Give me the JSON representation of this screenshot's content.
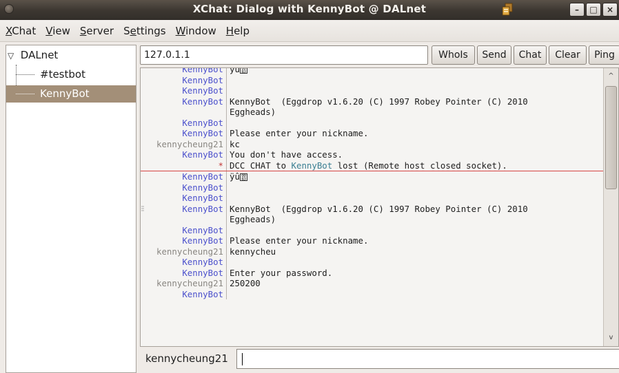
{
  "window": {
    "title": "XChat: Dialog with KennyBot @ DALnet",
    "controls": [
      "minimize",
      "maximize",
      "close"
    ],
    "app_icon": "xchat-icon"
  },
  "menubar": {
    "items": [
      {
        "label": "XChat",
        "mnemonic": "X"
      },
      {
        "label": "View",
        "mnemonic": "V"
      },
      {
        "label": "Server",
        "mnemonic": "S"
      },
      {
        "label": "Settings",
        "mnemonic": "e"
      },
      {
        "label": "Window",
        "mnemonic": "W"
      },
      {
        "label": "Help",
        "mnemonic": "H"
      }
    ]
  },
  "tree": {
    "network": "DALnet",
    "channels": [
      "#testbot",
      "KennyBot"
    ],
    "selected": "KennyBot"
  },
  "topic": {
    "value": "127.0.1.1"
  },
  "toolbar": {
    "buttons": [
      "WhoIs",
      "Send",
      "Chat",
      "Clear",
      "Ping"
    ]
  },
  "chat": {
    "lines": [
      {
        "nick": "KennyBot",
        "msg": "yu",
        "box": true
      },
      {
        "nick": "KennyBot",
        "msg": ""
      },
      {
        "nick": "KennyBot",
        "msg": ""
      },
      {
        "nick": "KennyBot",
        "msg": "KennyBot  (Eggdrop v1.6.20 (C) 1997 Robey Pointer (C) 2010"
      },
      {
        "nick": "",
        "msg": "Eggheads)"
      },
      {
        "nick": "KennyBot",
        "msg": ""
      },
      {
        "nick": "KennyBot",
        "msg": "Please enter your nickname."
      },
      {
        "nick": "kennycheung21",
        "msg": "kc",
        "self": true
      },
      {
        "nick": "KennyBot",
        "msg": "You don't have access."
      },
      {
        "nick": "*",
        "star": true,
        "msg_pre": "DCC CHAT to ",
        "msg_hl": "KennyBot",
        "msg_post": " lost (Remote host closed socket).",
        "marker_after": true
      },
      {
        "nick": "KennyBot",
        "msg": "ÿû",
        "box": true
      },
      {
        "nick": "KennyBot",
        "msg": ""
      },
      {
        "nick": "KennyBot",
        "msg": ""
      },
      {
        "nick": "KennyBot",
        "msg": "KennyBot  (Eggdrop v1.6.20 (C) 1997 Robey Pointer (C) 2010"
      },
      {
        "nick": "",
        "msg": "Eggheads)"
      },
      {
        "nick": "KennyBot",
        "msg": ""
      },
      {
        "nick": "KennyBot",
        "msg": "Please enter your nickname."
      },
      {
        "nick": "kennycheung21",
        "msg": "kennycheu",
        "self": true
      },
      {
        "nick": "KennyBot",
        "msg": ""
      },
      {
        "nick": "KennyBot",
        "msg": "Enter your password."
      },
      {
        "nick": "kennycheung21",
        "msg": "250200",
        "self": true
      },
      {
        "nick": "KennyBot",
        "msg": ""
      }
    ]
  },
  "input": {
    "nickname": "kennycheung21",
    "value": ""
  },
  "colors": {
    "titlebar": "#3c3731",
    "selection": "#a38f78",
    "nick": "#4b50cc",
    "self_nick": "#8a8782",
    "marker": "#d64444"
  }
}
